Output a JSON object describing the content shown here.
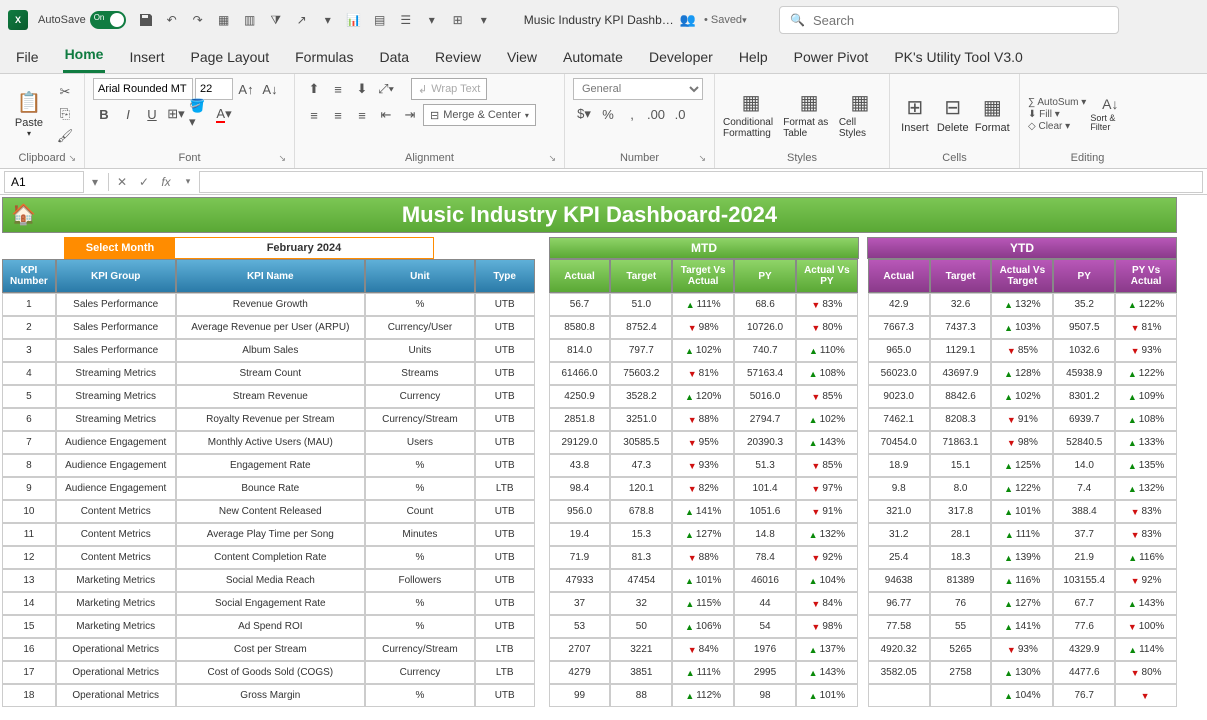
{
  "titlebar": {
    "autosave_label": "AutoSave",
    "autosave_state": "On",
    "doc_title": "Music Industry KPI Dashb…",
    "saved_status": "• Saved ",
    "search_placeholder": "Search"
  },
  "tabs": [
    "File",
    "Home",
    "Insert",
    "Page Layout",
    "Formulas",
    "Data",
    "Review",
    "View",
    "Automate",
    "Developer",
    "Help",
    "Power Pivot",
    "PK's Utility Tool V3.0"
  ],
  "active_tab": "Home",
  "ribbon": {
    "clipboard": {
      "paste": "Paste",
      "label": "Clipboard"
    },
    "font": {
      "name": "Arial Rounded MT",
      "size": "22",
      "label": "Font"
    },
    "alignment": {
      "wrap": "Wrap Text",
      "merge": "Merge & Center",
      "label": "Alignment"
    },
    "number": {
      "format": "General",
      "label": "Number"
    },
    "styles": {
      "cond": "Conditional Formatting",
      "tbl": "Format as Table",
      "cell": "Cell Styles",
      "label": "Styles"
    },
    "cells": {
      "ins": "Insert",
      "del": "Delete",
      "fmt": "Format",
      "label": "Cells"
    },
    "editing": {
      "sum": "AutoSum",
      "fill": "Fill",
      "clear": "Clear",
      "sort": "Sort & Filter",
      "label": "Editing"
    }
  },
  "namebox": "A1",
  "dashboard": {
    "title": "Music Industry KPI Dashboard-2024",
    "select_month_lbl": "Select Month",
    "month_value": "February 2024",
    "mtd_lbl": "MTD",
    "ytd_lbl": "YTD",
    "headers": {
      "num": "KPI Number",
      "grp": "KPI Group",
      "name": "KPI Name",
      "unit": "Unit",
      "type": "Type",
      "actual": "Actual",
      "target": "Target",
      "tva": "Target Vs Actual",
      "py": "PY",
      "avp": "Actual Vs PY",
      "avt": "Actual Vs Target",
      "pyva": "PY Vs Actual"
    }
  },
  "rows": [
    {
      "n": "1",
      "g": "Sales Performance",
      "name": "Revenue Growth",
      "unit": "%",
      "type": "UTB",
      "m": [
        "56.7",
        "51.0",
        "▲111%",
        "68.6",
        "▼83%"
      ],
      "y": [
        "42.9",
        "32.6",
        "▲132%",
        "35.2",
        "▲122%"
      ]
    },
    {
      "n": "2",
      "g": "Sales Performance",
      "name": "Average Revenue per User (ARPU)",
      "unit": "Currency/User",
      "type": "UTB",
      "m": [
        "8580.8",
        "8752.4",
        "▼98%",
        "10726.0",
        "▼80%"
      ],
      "y": [
        "7667.3",
        "7437.3",
        "▲103%",
        "9507.5",
        "▼81%"
      ]
    },
    {
      "n": "3",
      "g": "Sales Performance",
      "name": "Album Sales",
      "unit": "Units",
      "type": "UTB",
      "m": [
        "814.0",
        "797.7",
        "▲102%",
        "740.7",
        "▲110%"
      ],
      "y": [
        "965.0",
        "1129.1",
        "▼85%",
        "1032.6",
        "▼93%"
      ]
    },
    {
      "n": "4",
      "g": "Streaming Metrics",
      "name": "Stream Count",
      "unit": "Streams",
      "type": "UTB",
      "m": [
        "61466.0",
        "75603.2",
        "▼81%",
        "57163.4",
        "▲108%"
      ],
      "y": [
        "56023.0",
        "43697.9",
        "▲128%",
        "45938.9",
        "▲122%"
      ]
    },
    {
      "n": "5",
      "g": "Streaming Metrics",
      "name": "Stream Revenue",
      "unit": "Currency",
      "type": "UTB",
      "m": [
        "4250.9",
        "3528.2",
        "▲120%",
        "5016.0",
        "▼85%"
      ],
      "y": [
        "9023.0",
        "8842.6",
        "▲102%",
        "8301.2",
        "▲109%"
      ]
    },
    {
      "n": "6",
      "g": "Streaming Metrics",
      "name": "Royalty Revenue per Stream",
      "unit": "Currency/Stream",
      "type": "UTB",
      "m": [
        "2851.8",
        "3251.0",
        "▼88%",
        "2794.7",
        "▲102%"
      ],
      "y": [
        "7462.1",
        "8208.3",
        "▼91%",
        "6939.7",
        "▲108%"
      ]
    },
    {
      "n": "7",
      "g": "Audience Engagement",
      "name": "Monthly Active Users (MAU)",
      "unit": "Users",
      "type": "UTB",
      "m": [
        "29129.0",
        "30585.5",
        "▼95%",
        "20390.3",
        "▲143%"
      ],
      "y": [
        "70454.0",
        "71863.1",
        "▼98%",
        "52840.5",
        "▲133%"
      ]
    },
    {
      "n": "8",
      "g": "Audience Engagement",
      "name": "Engagement Rate",
      "unit": "%",
      "type": "UTB",
      "m": [
        "43.8",
        "47.3",
        "▼93%",
        "51.3",
        "▼85%"
      ],
      "y": [
        "18.9",
        "15.1",
        "▲125%",
        "14.0",
        "▲135%"
      ]
    },
    {
      "n": "9",
      "g": "Audience Engagement",
      "name": "Bounce Rate",
      "unit": "%",
      "type": "LTB",
      "m": [
        "98.4",
        "120.1",
        "▼82%",
        "101.4",
        "▼97%"
      ],
      "y": [
        "9.8",
        "8.0",
        "▲122%",
        "7.4",
        "▲132%"
      ]
    },
    {
      "n": "10",
      "g": "Content Metrics",
      "name": "New Content Released",
      "unit": "Count",
      "type": "UTB",
      "m": [
        "956.0",
        "678.8",
        "▲141%",
        "1051.6",
        "▼91%"
      ],
      "y": [
        "321.0",
        "317.8",
        "▲101%",
        "388.4",
        "▼83%"
      ]
    },
    {
      "n": "11",
      "g": "Content Metrics",
      "name": "Average Play Time per Song",
      "unit": "Minutes",
      "type": "UTB",
      "m": [
        "19.4",
        "15.3",
        "▲127%",
        "14.8",
        "▲132%"
      ],
      "y": [
        "31.2",
        "28.1",
        "▲111%",
        "37.7",
        "▼83%"
      ]
    },
    {
      "n": "12",
      "g": "Content Metrics",
      "name": "Content Completion Rate",
      "unit": "%",
      "type": "UTB",
      "m": [
        "71.9",
        "81.3",
        "▼88%",
        "78.4",
        "▼92%"
      ],
      "y": [
        "25.4",
        "18.3",
        "▲139%",
        "21.9",
        "▲116%"
      ]
    },
    {
      "n": "13",
      "g": "Marketing Metrics",
      "name": "Social Media Reach",
      "unit": "Followers",
      "type": "UTB",
      "m": [
        "47933",
        "47454",
        "▲101%",
        "46016",
        "▲104%"
      ],
      "y": [
        "94638",
        "81389",
        "▲116%",
        "103155.4",
        "▼92%"
      ]
    },
    {
      "n": "14",
      "g": "Marketing Metrics",
      "name": "Social Engagement Rate",
      "unit": "%",
      "type": "UTB",
      "m": [
        "37",
        "32",
        "▲115%",
        "44",
        "▼84%"
      ],
      "y": [
        "96.77",
        "76",
        "▲127%",
        "67.7",
        "▲143%"
      ]
    },
    {
      "n": "15",
      "g": "Marketing Metrics",
      "name": "Ad Spend ROI",
      "unit": "%",
      "type": "UTB",
      "m": [
        "53",
        "50",
        "▲106%",
        "54",
        "▼98%"
      ],
      "y": [
        "77.58",
        "55",
        "▲141%",
        "77.6",
        "▼100%"
      ]
    },
    {
      "n": "16",
      "g": "Operational Metrics",
      "name": "Cost per Stream",
      "unit": "Currency/Stream",
      "type": "LTB",
      "m": [
        "2707",
        "3221",
        "▼84%",
        "1976",
        "▲137%"
      ],
      "y": [
        "4920.32",
        "5265",
        "▼93%",
        "4329.9",
        "▲114%"
      ]
    },
    {
      "n": "17",
      "g": "Operational Metrics",
      "name": "Cost of Goods Sold (COGS)",
      "unit": "Currency",
      "type": "LTB",
      "m": [
        "4279",
        "3851",
        "▲111%",
        "2995",
        "▲143%"
      ],
      "y": [
        "3582.05",
        "2758",
        "▲130%",
        "4477.6",
        "▼80%"
      ]
    },
    {
      "n": "18",
      "g": "Operational Metrics",
      "name": "Gross Margin",
      "unit": "%",
      "type": "UTB",
      "m": [
        "99",
        "88",
        "▲112%",
        "98",
        "▲101%"
      ],
      "y": [
        "",
        "",
        "▲104%",
        "76.7",
        "▼"
      ]
    }
  ]
}
